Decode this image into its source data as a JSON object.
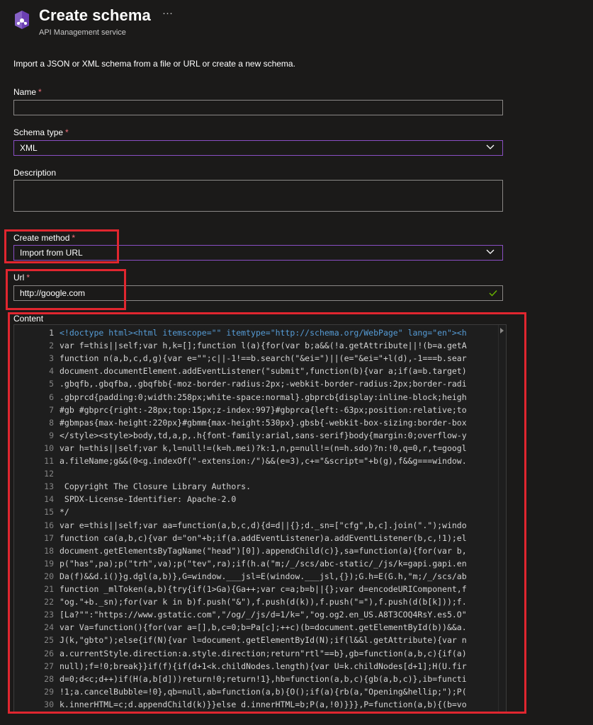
{
  "header": {
    "title": "Create schema",
    "subtitle": "API Management service",
    "more_label": "···",
    "icon": "api-management-icon"
  },
  "intro": "Import a JSON or XML schema from a file or URL or create a new schema.",
  "form": {
    "name": {
      "label": "Name",
      "required": "*",
      "value": ""
    },
    "schema_type": {
      "label": "Schema type",
      "required": "*",
      "value": "XML"
    },
    "description": {
      "label": "Description",
      "value": ""
    },
    "create_method": {
      "label": "Create method",
      "required": "*",
      "value": "Import from URL"
    },
    "url": {
      "label": "Url",
      "required": "*",
      "value": "http://google.com"
    },
    "content": {
      "label": "Content"
    }
  },
  "colors": {
    "accent": "#8a4fc4",
    "highlight_red": "#e0262f",
    "required": "#f1707b",
    "valid_check": "#6bb700"
  },
  "editor": {
    "line_numbers": [
      "1",
      "2",
      "3",
      "4",
      "5",
      "6",
      "7",
      "8",
      "9",
      "10",
      "11",
      "12",
      "13",
      "14",
      "15",
      "16",
      "17",
      "18",
      "19",
      "20",
      "21",
      "22",
      "23",
      "24",
      "25",
      "26",
      "27",
      "28",
      "29",
      "30"
    ],
    "lines": [
      "<!doctype html><html itemscope=\"\" itemtype=\"http://schema.org/WebPage\" lang=\"en\"><h",
      "var f=this||self;var h,k=[];function l(a){for(var b;a&&(!a.getAttribute||!(b=a.getA",
      "function n(a,b,c,d,g){var e=\"\";c||-1!==b.search(\"&ei=\")||(e=\"&ei=\"+l(d),-1===b.sear",
      "document.documentElement.addEventListener(\"submit\",function(b){var a;if(a=b.target)",
      ".gbqfb,.gbqfba,.gbqfbb{-moz-border-radius:2px;-webkit-border-radius:2px;border-radi",
      ".gbprcd{padding:0;width:258px;white-space:normal}.gbprcb{display:inline-block;heigh",
      "#gb #gbprc{right:-28px;top:15px;z-index:997}#gbprca{left:-63px;position:relative;to",
      "#gbmpas{max-height:220px}#gbmm{max-height:530px}.gbsb{-webkit-box-sizing:border-box",
      "</style><style>body,td,a,p,.h{font-family:arial,sans-serif}body{margin:0;overflow-y",
      "var h=this||self;var k,l=null!=(k=h.mei)?k:1,n,p=null!=(n=h.sdo)?n:!0,q=0,r,t=googl",
      "a.fileName;g&&(0<g.indexOf(\"-extension:/\")&&(e=3),c+=\"&script=\"+b(g),f&&g===window.",
      "",
      " Copyright The Closure Library Authors.",
      " SPDX-License-Identifier: Apache-2.0",
      "*/",
      "var e=this||self;var aa=function(a,b,c,d){d=d||{};d._sn=[\"cfg\",b,c].join(\".\");windo",
      "function ca(a,b,c){var d=\"on\"+b;if(a.addEventListener)a.addEventListener(b,c,!1);el",
      "document.getElementsByTagName(\"head\")[0]).appendChild(c)},sa=function(a){for(var b,",
      "p(\"has\",pa);p(\"trh\",va);p(\"tev\",ra);if(h.a(\"m;/_/scs/abc-static/_/js/k=gapi.gapi.en",
      "Da(f)&&d.i()}g.dgl(a,b)},G=window.___jsl=E(window.___jsl,{});G.h=E(G.h,\"m;/_/scs/ab",
      "function _mlToken(a,b){try{if(1>Ga){Ga++;var c=a;b=b||{};var d=encodeURIComponent,f",
      "\"og.\"+b._sn);for(var k in b)f.push(\"&\"),f.push(d(k)),f.push(\"=\"),f.push(d(b[k]));f.",
      "[La?\"\":\"https://www.gstatic.com\",\"/og/_/js/d=1/k=\",\"og.og2.en_US.A8T3COQ4RsY.es5.O\"",
      "var Va=function(){for(var a=[],b,c=0;b=Pa[c];++c)(b=document.getElementById(b))&&a.",
      "J(k,\"gbto\");else{if(N){var l=document.getElementById(N);if(l&&l.getAttribute){var n",
      "a.currentStyle.direction:a.style.direction;return\"rtl\"==b},gb=function(a,b,c){if(a)",
      "null);f=!0;break}}if(f){if(d+1<k.childNodes.length){var U=k.childNodes[d+1];H(U.fir",
      "d=0;d<c;d++)if(H(a,b[d]))return!0;return!1},hb=function(a,b,c){gb(a,b,c)},ib=functi",
      "!1;a.cancelBubble=!0},qb=null,ab=function(a,b){O();if(a){rb(a,\"Opening&hellip;\");P(",
      "k.innerHTML=c;d.appendChild(k)}}else d.innerHTML=b;P(a,!0)}}},P=function(a,b){(b=vo"
    ]
  }
}
